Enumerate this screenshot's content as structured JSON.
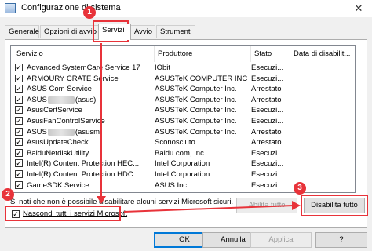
{
  "window": {
    "title": "Configurazione di sistema",
    "close_glyph": "✕"
  },
  "tabs": [
    "Generale",
    "Opzioni di avvio",
    "Servizi",
    "Avvio",
    "Strumenti"
  ],
  "table": {
    "headers": [
      "Servizio",
      "Produttore",
      "Stato",
      "Data di disabilit..."
    ],
    "rows": [
      {
        "pre": "Advanced SystemCare Service 17",
        "post": "",
        "redacted": false,
        "vendor": "IObit",
        "status": "Esecuzi..."
      },
      {
        "pre": "ARMOURY CRATE Service",
        "post": "",
        "redacted": false,
        "vendor": "ASUSTeK COMPUTER INC.",
        "status": "Esecuzi..."
      },
      {
        "pre": "ASUS Com Service",
        "post": "",
        "redacted": false,
        "vendor": "ASUSTeK Computer Inc.",
        "status": "Arrestato"
      },
      {
        "pre": "ASUS",
        "post": "(asus)",
        "redacted": true,
        "vendor": "ASUSTeK Computer Inc.",
        "status": "Arrestato"
      },
      {
        "pre": "AsusCertService",
        "post": "",
        "redacted": false,
        "vendor": "ASUSTeK Computer Inc.",
        "status": "Esecuzi..."
      },
      {
        "pre": "AsusFanControlService",
        "post": "",
        "redacted": false,
        "vendor": "ASUSTeK Computer Inc.",
        "status": "Esecuzi..."
      },
      {
        "pre": "ASUS",
        "post": "(asusm)",
        "redacted": true,
        "vendor": "ASUSTeK Computer Inc.",
        "status": "Arrestato"
      },
      {
        "pre": "AsusUpdateCheck",
        "post": "",
        "redacted": false,
        "vendor": "Sconosciuto",
        "status": "Arrestato"
      },
      {
        "pre": "BaiduNetdiskUtility",
        "post": "",
        "redacted": false,
        "vendor": "Baidu.com, Inc.",
        "status": "Esecuzi..."
      },
      {
        "pre": "Intel(R) Content Protection HEC...",
        "post": "",
        "redacted": false,
        "vendor": "Intel Corporation",
        "status": "Esecuzi..."
      },
      {
        "pre": "Intel(R) Content Protection HDC...",
        "post": "",
        "redacted": false,
        "vendor": "Intel Corporation",
        "status": "Esecuzi..."
      },
      {
        "pre": "GameSDK Service",
        "post": "",
        "redacted": false,
        "vendor": "ASUS Inc.",
        "status": "Esecuzi..."
      }
    ]
  },
  "note": "Si noti che non è possibile disabilitare alcuni servizi Microsoft sicuri.",
  "hide_ms_label": "Nascondi tutti i servizi Microsoft",
  "checked_glyph": "✓",
  "buttons": {
    "enable_all": "Abilita tutto",
    "disable_all": "Disabilita tutto",
    "ok": "OK",
    "cancel": "Annulla",
    "apply": "Applica",
    "help": "?"
  },
  "annotations": [
    "1",
    "2",
    "3"
  ],
  "colors": {
    "annotation": "#e8333a",
    "accent": "#0078d7"
  }
}
